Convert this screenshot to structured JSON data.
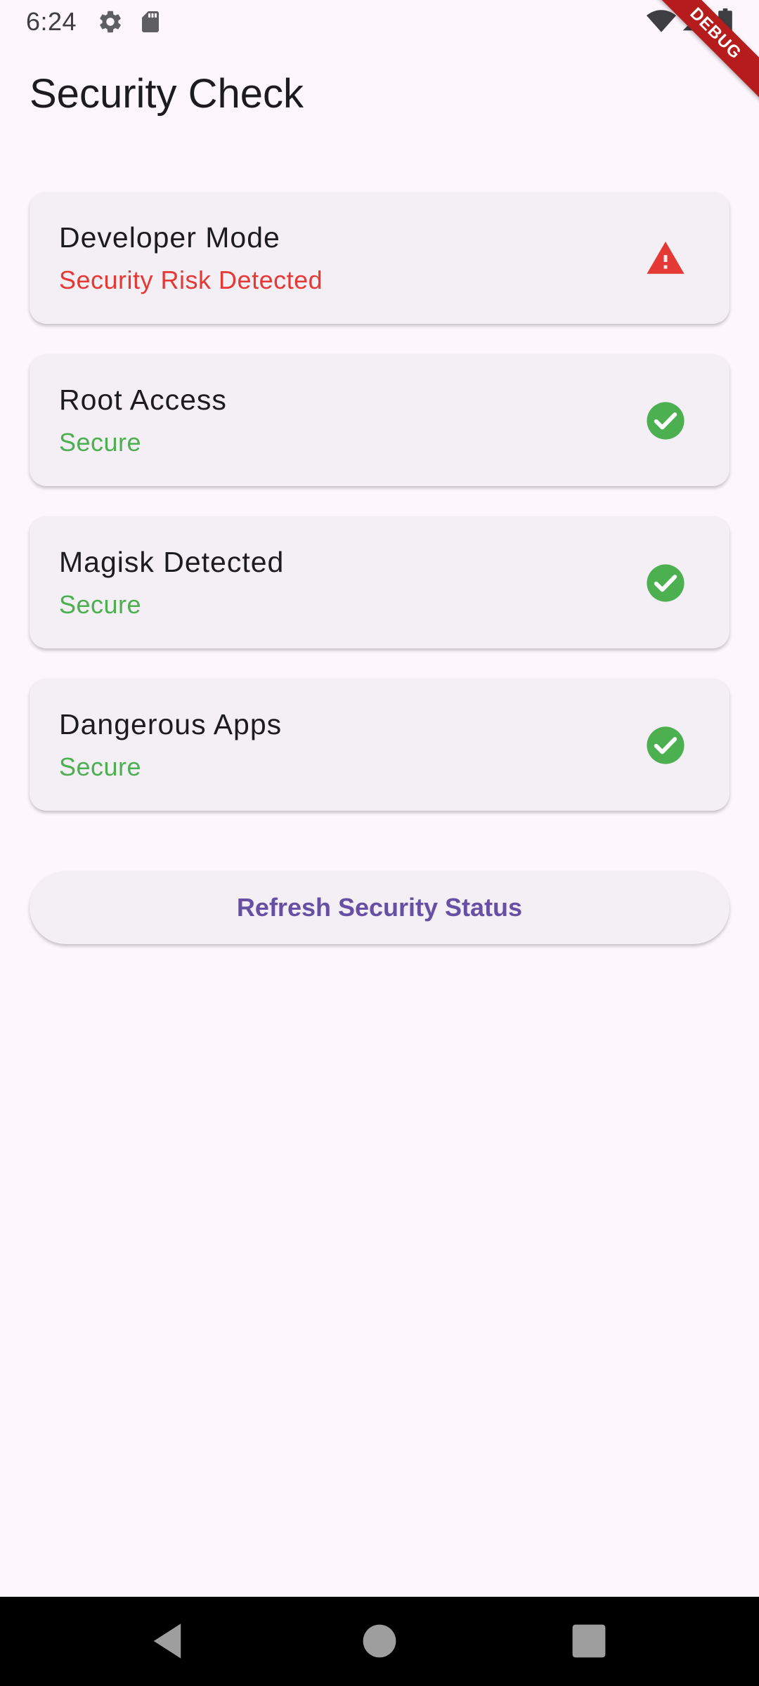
{
  "status_bar": {
    "time": "6:24",
    "icons": [
      "gear-icon",
      "sd-card-icon",
      "wifi-icon",
      "signal-icon",
      "battery-icon"
    ]
  },
  "debug_banner": {
    "label": "DEBUG"
  },
  "header": {
    "title": "Security Check"
  },
  "checks": [
    {
      "title": "Developer Mode",
      "status": "Security Risk Detected",
      "state": "risk",
      "icon": "warning-icon"
    },
    {
      "title": "Root Access",
      "status": "Secure",
      "state": "secure",
      "icon": "check-circle-icon"
    },
    {
      "title": "Magisk Detected",
      "status": "Secure",
      "state": "secure",
      "icon": "check-circle-icon"
    },
    {
      "title": "Dangerous Apps",
      "status": "Secure",
      "state": "secure",
      "icon": "check-circle-icon"
    }
  ],
  "refresh_button": {
    "label": "Refresh Security Status"
  },
  "nav_bar": {
    "buttons": [
      "back-icon",
      "home-icon",
      "recents-icon"
    ]
  },
  "colors": {
    "background": "#FDF7FD",
    "card": "#F3EFF5",
    "risk": "#E53935",
    "secure": "#4CAF50",
    "primary": "#6750A4",
    "debug": "#B71C1C"
  }
}
